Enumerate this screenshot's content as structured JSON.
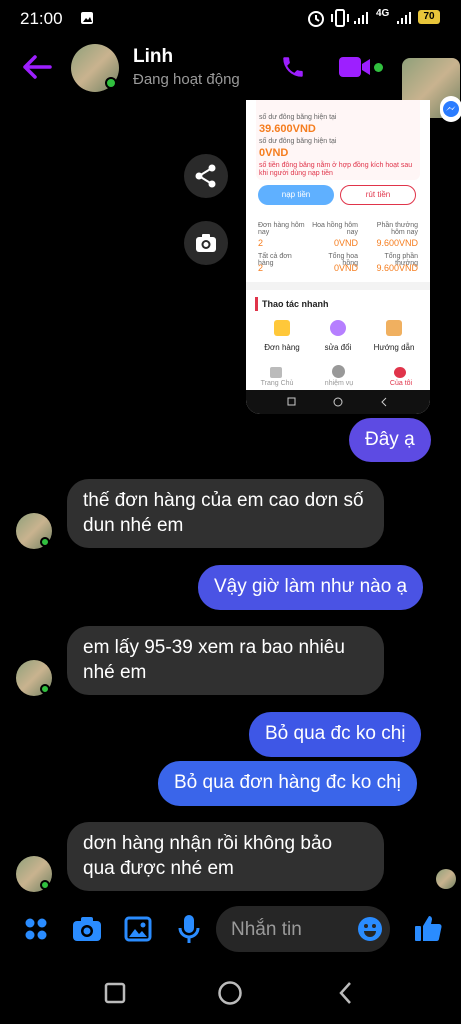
{
  "status_bar": {
    "time": "21:00",
    "network": "4G",
    "battery": "70"
  },
  "header": {
    "contact_name": "Linh",
    "contact_status": "Đang hoạt động"
  },
  "shared_screenshot": {
    "balance_label": "số dư đông băng hiện tại",
    "balance_value": "39.600VND",
    "frozen_label": "số dư đông băng hiện tại",
    "frozen_value": "0VND",
    "note": "số tiền đông băng nằm ở hợp đồng kích hoạt sau khi người dùng nạp tiền",
    "deposit_button": "nạp tiền",
    "withdraw_button": "rút tiền",
    "stats": [
      {
        "label": "Đơn hàng hôm nay",
        "value": "2"
      },
      {
        "label": "Hoa hồng hôm nay",
        "value": "0VND"
      },
      {
        "label": "Phần thưởng hôm nay",
        "value": "9.600VND"
      },
      {
        "label": "Tất cả đơn hàng",
        "value": "2"
      },
      {
        "label": "Tổng hoa hồng",
        "value": "0VND"
      },
      {
        "label": "Tổng phần thưởng",
        "value": "9.600VND"
      }
    ],
    "quick_title": "Thao tác nhanh",
    "quick_items": [
      "Đơn hàng",
      "sửa đổi",
      "Hướng dẫn"
    ],
    "tab_items": [
      "Trang Chủ",
      "nhiệm vụ",
      "Của tôi"
    ]
  },
  "messages": [
    {
      "side": "out",
      "text": "Đây ạ"
    },
    {
      "side": "in",
      "text": "thế đơn hàng của em  cao dơn số dun nhé em"
    },
    {
      "side": "out",
      "text": "Vậy giờ làm như nào ạ"
    },
    {
      "side": "in",
      "text": "em lấy 95-39 xem ra bao nhiêu nhé em"
    },
    {
      "side": "out",
      "text": "Bỏ qua đc ko chị"
    },
    {
      "side": "out",
      "text": "Bỏ qua đơn hàng đc ko chị"
    },
    {
      "side": "in",
      "text": "dơn hàng nhận rồi không bảo qua được nhé em"
    }
  ],
  "composer": {
    "placeholder": "Nhắn tin"
  },
  "colors": {
    "accent_purple": "#9d1fff",
    "outgoing_blue": "#3e57e6",
    "incoming_gray": "#303030",
    "online_green": "#31c03f"
  }
}
